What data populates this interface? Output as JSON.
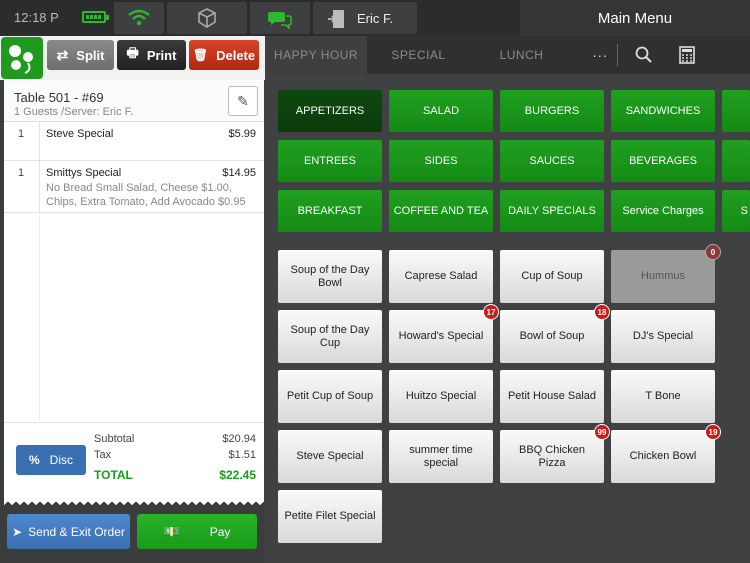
{
  "status": {
    "time": "12:18 P"
  },
  "header": {
    "user": "Eric F.",
    "title": "Main Menu"
  },
  "toolbar": {
    "split": "Split",
    "print": "Print",
    "delete": "Delete"
  },
  "order": {
    "table": "Table 501 -  #69",
    "guests_server": "1 Guests /Server: Eric F.",
    "items": [
      {
        "qty": "1",
        "name": "Steve Special",
        "price": "$5.99",
        "mods": ""
      },
      {
        "qty": "1",
        "name": "Smittys Special",
        "price": "$14.95",
        "mods": "No Bread Small Salad, Cheese $1.00, Chips, Extra Tomato, Add Avocado $0.95"
      }
    ],
    "subtotal_label": "Subtotal",
    "subtotal": "$20.94",
    "tax_label": "Tax",
    "tax": "$1.51",
    "total_label": "TOTAL",
    "total": "$22.45",
    "disc": "Disc"
  },
  "actions": {
    "send": "Send & Exit Order",
    "pay": "Pay"
  },
  "tabs": [
    "HAPPY HOUR",
    "SPECIAL",
    "LUNCH"
  ],
  "more": "···",
  "categories": [
    "APPETIZERS",
    "SALAD",
    "BURGERS",
    "SANDWICHES",
    "ENTREES",
    "SIDES",
    "SAUCES",
    "BEVERAGES",
    "BREAKFAST",
    "COFFEE AND TEA",
    "DAILY SPECIALS",
    "Service Charges"
  ],
  "items": [
    {
      "label": "Soup of the Day Bowl",
      "badge": ""
    },
    {
      "label": "Caprese Salad",
      "badge": ""
    },
    {
      "label": "Cup of Soup",
      "badge": ""
    },
    {
      "label": "Hummus",
      "badge": "0"
    },
    {
      "label": "Soup of the Day Cup",
      "badge": ""
    },
    {
      "label": "Howard's Special",
      "badge": "17"
    },
    {
      "label": "Bowl of Soup",
      "badge": "18"
    },
    {
      "label": "DJ's Special",
      "badge": ""
    },
    {
      "label": "Petit Cup of Soup",
      "badge": ""
    },
    {
      "label": "Huitzo Special",
      "badge": ""
    },
    {
      "label": "Petit House Salad",
      "badge": ""
    },
    {
      "label": "T Bone",
      "badge": ""
    },
    {
      "label": "Steve Special",
      "badge": ""
    },
    {
      "label": "summer time special",
      "badge": ""
    },
    {
      "label": "BBQ Chicken Pizza",
      "badge": "99"
    },
    {
      "label": "Chicken Bowl",
      "badge": "19"
    },
    {
      "label": "Petite Filet Special",
      "badge": ""
    }
  ],
  "colors": {
    "accent_green": "#1f9a1f",
    "accent_blue": "#3a6fb2",
    "danger": "#c0301c"
  }
}
